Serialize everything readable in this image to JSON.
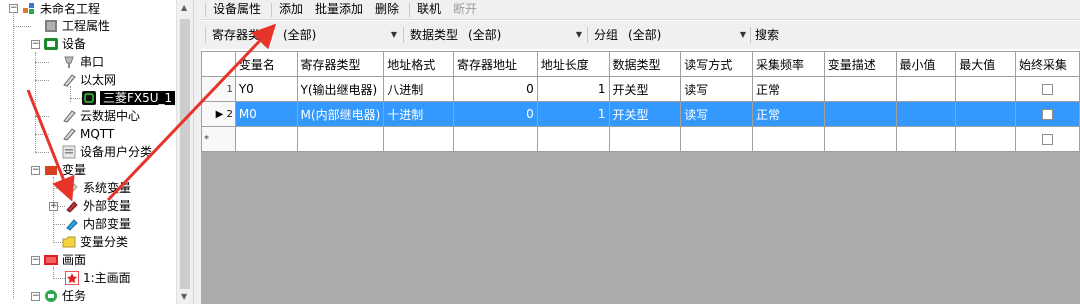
{
  "tree": {
    "project": "未命名工程",
    "project_props": "工程属性",
    "devices": "设备",
    "serial": "串口",
    "ethernet": "以太网",
    "selected_device": "三菱FX5U_1",
    "cloud": "云数据中心",
    "mqtt": "MQTT",
    "device_user_category": "设备用户分类",
    "variables": "变量",
    "system_vars": "系统变量",
    "external_vars": "外部变量",
    "internal_vars": "内部变量",
    "var_category": "变量分类",
    "screens": "画面",
    "main_screen": "1:主画面",
    "tasks": "任务"
  },
  "toolbar": {
    "device_props": "设备属性",
    "add": "添加",
    "batch_add": "批量添加",
    "delete": "删除",
    "online": "联机",
    "disconnect": "断开"
  },
  "filter": {
    "register_type_label": "寄存器类型",
    "register_type_value": "(全部)",
    "data_type_label": "数据类型",
    "data_type_value": "(全部)",
    "group_label": "分组",
    "group_value": "(全部)",
    "search": "搜索"
  },
  "grid": {
    "columns": [
      "变量名",
      "寄存器类型",
      "地址格式",
      "寄存器地址",
      "地址长度",
      "数据类型",
      "读写方式",
      "采集频率",
      "变量描述",
      "最小值",
      "最大值",
      "始终采集"
    ],
    "rows": [
      {
        "index": "1",
        "name": "Y0",
        "reg_type": "Y(输出继电器)",
        "addr_format": "八进制",
        "reg_addr": "0",
        "addr_len": "1",
        "data_type": "开关型",
        "rw": "读写",
        "freq": "正常",
        "desc": "",
        "min": "",
        "max": "",
        "always": false
      },
      {
        "index": "2",
        "name": "M0",
        "reg_type": "M(内部继电器)",
        "addr_format": "十进制",
        "reg_addr": "0",
        "addr_len": "1",
        "data_type": "开关型",
        "rw": "读写",
        "freq": "正常",
        "desc": "",
        "min": "",
        "max": "",
        "always": false
      }
    ],
    "new_row_marker": "*"
  },
  "colors": {
    "selection": "#3399ff",
    "arrow": "#e8332a"
  },
  "icons": [
    "project-icon",
    "properties-icon",
    "device-icon",
    "serial-icon",
    "ethernet-icon",
    "plc-icon",
    "cloud-icon",
    "mqtt-icon",
    "user-category-icon",
    "variable-icon",
    "system-var-icon",
    "external-var-icon",
    "internal-var-icon",
    "folder-icon",
    "screen-icon",
    "main-screen-icon",
    "task-icon"
  ]
}
